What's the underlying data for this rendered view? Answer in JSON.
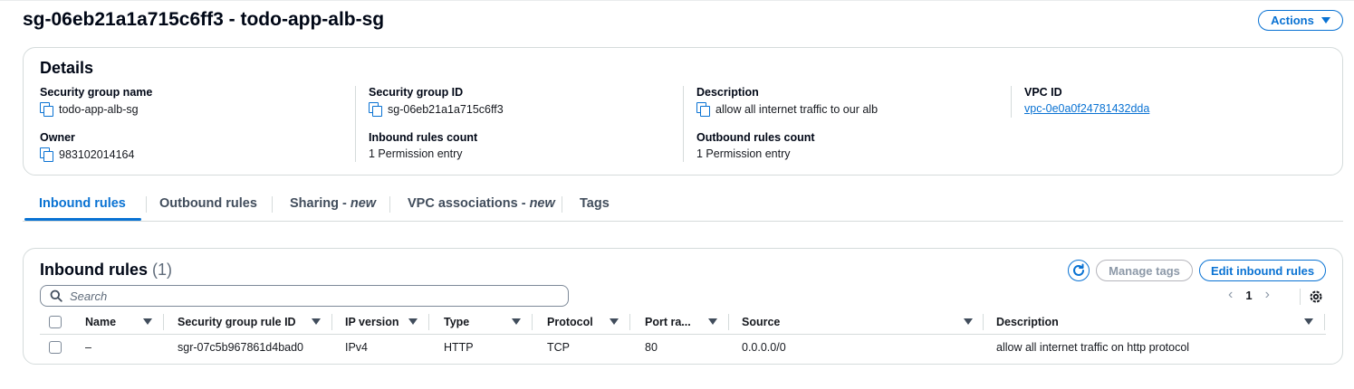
{
  "page": {
    "title": "sg-06eb21a1a715c6ff3 - todo-app-alb-sg",
    "actions_label": "Actions"
  },
  "details": {
    "heading": "Details",
    "fields": {
      "sg_name": {
        "label": "Security group name",
        "value": "todo-app-alb-sg"
      },
      "sg_id": {
        "label": "Security group ID",
        "value": "sg-06eb21a1a715c6ff3"
      },
      "description": {
        "label": "Description",
        "value": "allow all internet traffic to our alb"
      },
      "vpc_id": {
        "label": "VPC ID",
        "value": "vpc-0e0a0f24781432dda"
      },
      "owner": {
        "label": "Owner",
        "value": "983102014164"
      },
      "inbound_count": {
        "label": "Inbound rules count",
        "value": "1 Permission entry"
      },
      "outbound_count": {
        "label": "Outbound rules count",
        "value": "1 Permission entry"
      }
    }
  },
  "tabs": {
    "inbound": "Inbound rules",
    "outbound": "Outbound rules",
    "sharing": "Sharing - ",
    "sharing_new": "new",
    "vpc_assoc": "VPC associations - ",
    "vpc_assoc_new": "new",
    "tags": "Tags"
  },
  "rules": {
    "heading": "Inbound rules",
    "count": "(1)",
    "manage_tags_label": "Manage tags",
    "edit_label": "Edit inbound rules",
    "search_placeholder": "Search",
    "page_number": "1",
    "columns": {
      "name": "Name",
      "rule_id": "Security group rule ID",
      "ip_version": "IP version",
      "type": "Type",
      "protocol": "Protocol",
      "port_range": "Port ra...",
      "source": "Source",
      "description": "Description"
    },
    "rows": [
      {
        "name": "–",
        "rule_id": "sgr-07c5b967861d4bad0",
        "ip_version": "IPv4",
        "type": "HTTP",
        "protocol": "TCP",
        "port_range": "80",
        "source": "0.0.0.0/0",
        "description": "allow all internet traffic on http protocol"
      }
    ]
  },
  "icons": {
    "copy": "copy-icon",
    "refresh": "refresh-icon",
    "search": "search-icon",
    "gear": "gear-icon"
  },
  "colors": {
    "accent": "#0972d3",
    "border": "#d5dbdb",
    "disabled": "#8d99a8"
  }
}
